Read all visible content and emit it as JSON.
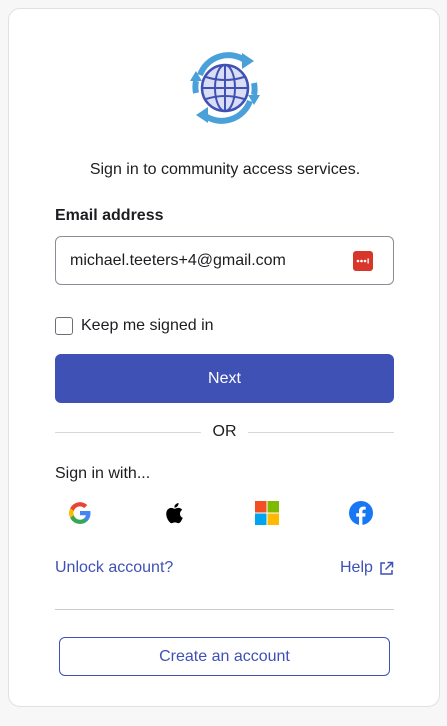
{
  "subtitle": "Sign in to community access services.",
  "email": {
    "label": "Email address",
    "value": "michael.teeters+4@gmail.com",
    "password_manager_icon": "password-manager-icon"
  },
  "keep_signed_in": {
    "label": "Keep me signed in",
    "checked": false
  },
  "next_button": "Next",
  "divider_text": "OR",
  "sign_in_with": "Sign in with...",
  "social_providers": [
    "google",
    "apple",
    "microsoft",
    "facebook"
  ],
  "links": {
    "unlock": "Unlock account?",
    "help": "Help"
  },
  "create_account_button": "Create an account",
  "colors": {
    "primary": "#3f51b5",
    "password_icon": "#d9362b"
  }
}
